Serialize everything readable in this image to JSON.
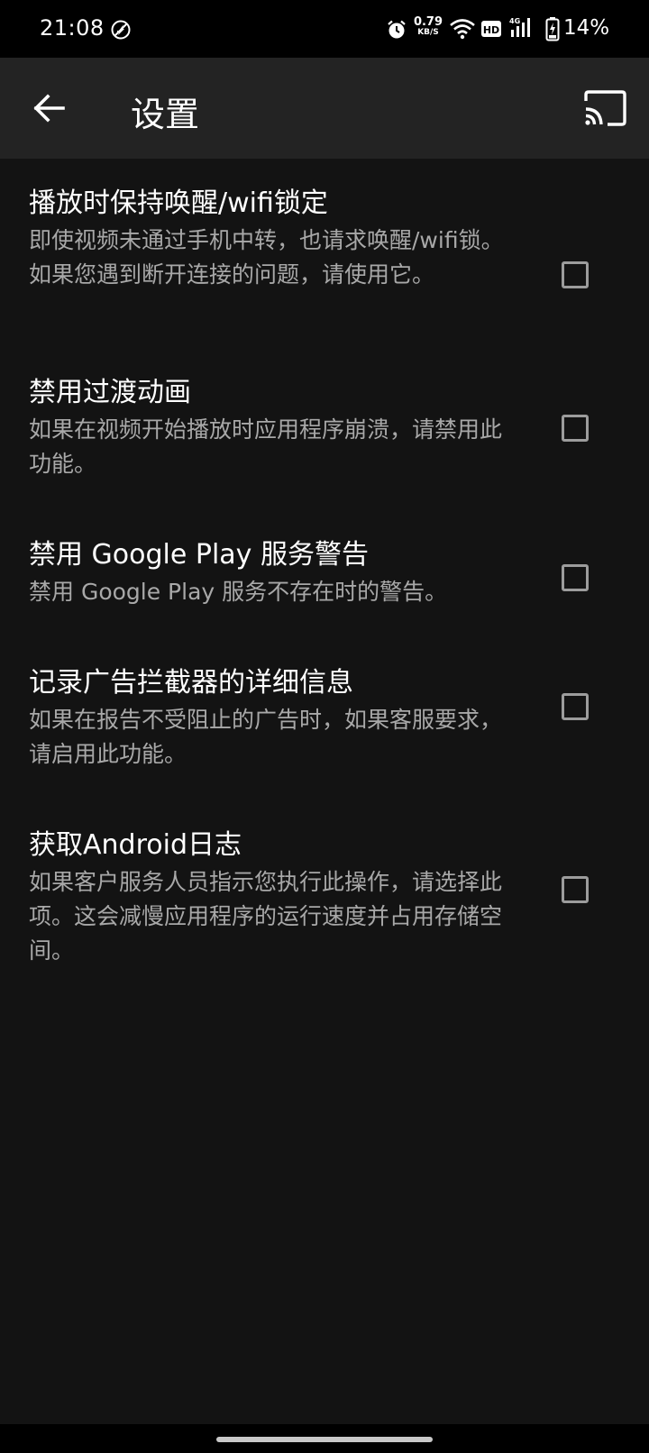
{
  "status_bar": {
    "time": "21:08",
    "net_speed_value": "0.79",
    "net_speed_unit": "KB/S",
    "hd_label": "HD",
    "network_type": "4G",
    "battery_percent": "14%"
  },
  "app_bar": {
    "title": "设置",
    "back_icon": "arrow-back-icon",
    "cast_icon": "cast-icon"
  },
  "settings": [
    {
      "title": "播放时保持唤醒/wifi锁定",
      "desc": "即使视频未通过手机中转，也请求唤醒/wifi锁。如果您遇到断开连接的问题，请使用它。",
      "checked": false
    },
    {
      "title": "禁用过渡动画",
      "desc": "如果在视频开始播放时应用程序崩溃，请禁用此功能。",
      "checked": false
    },
    {
      "title": "禁用 Google Play 服务警告",
      "desc": "禁用 Google Play 服务不存在时的警告。",
      "checked": false
    },
    {
      "title": "记录广告拦截器的详细信息",
      "desc": "如果在报告不受阻止的广告时，如果客服要求，请启用此功能。",
      "checked": false
    },
    {
      "title": "获取Android日志",
      "desc": "如果客户服务人员指示您执行此操作，请选择此项。这会减慢应用程序的运行速度并占用存储空间。",
      "checked": false
    }
  ],
  "colors": {
    "background": "#131313",
    "app_bar": "#232323",
    "title_text": "#ffffff",
    "desc_text": "#a8a8a8",
    "checkbox_border": "#9c9c9c"
  }
}
